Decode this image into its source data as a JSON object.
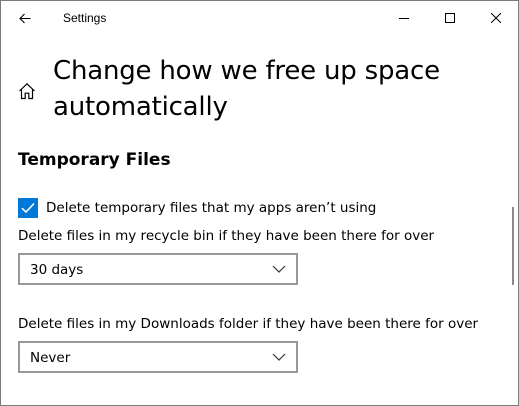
{
  "titlebar": {
    "title": "Settings",
    "back_icon": "back-arrow-icon",
    "minimize_icon": "minimize-icon",
    "maximize_icon": "maximize-icon",
    "close_icon": "close-icon"
  },
  "header": {
    "home_icon": "home-icon",
    "title": "Change how we free up space automatically"
  },
  "temporary_files": {
    "heading": "Temporary Files",
    "delete_temp": {
      "label": "Delete temporary files that my apps aren’t using",
      "checked": true
    },
    "recycle_bin": {
      "label": "Delete files in my recycle bin if they have been there for over",
      "selected": "30 days"
    },
    "downloads": {
      "label": "Delete files in my Downloads folder if they have been there for over",
      "selected": "Never"
    }
  },
  "colors": {
    "accent": "#0078d7",
    "dropdown_border": "#999999",
    "window_border": "#7a7a7a"
  }
}
